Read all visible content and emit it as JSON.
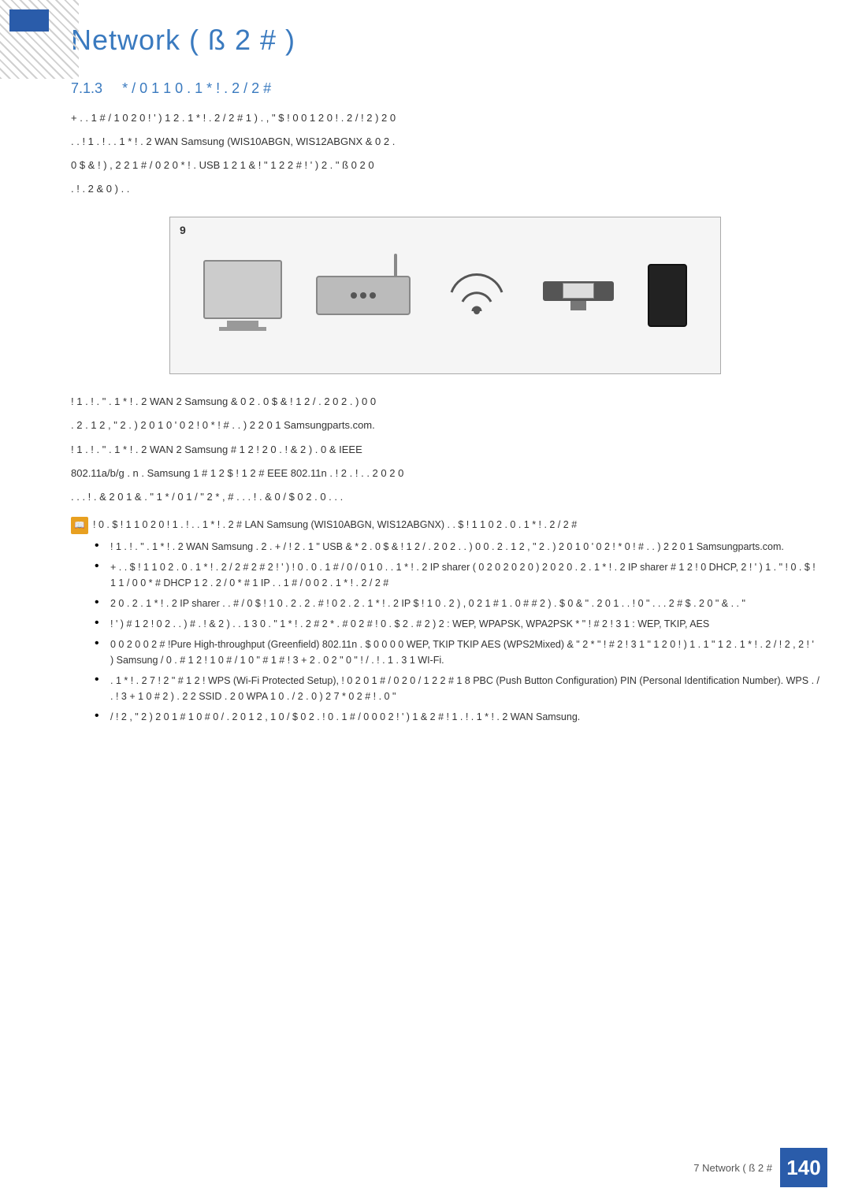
{
  "page": {
    "title": "Network ( ß   2 # )",
    "left_strip_visible": true,
    "footer": {
      "text": "7 Network ( ß  2 #",
      "page_number": "140"
    }
  },
  "header": {
    "section_number": "7.1.3",
    "section_title": "* / 0 1  1 0 . 1 * ! . 2 /   2 #"
  },
  "image": {
    "number": "9"
  },
  "paragraphs": {
    "p1": "+ . . 1 #  /  1 0 2 0 !  ' )  1 2 . 1 * ! . 2 /   2 # 1 ) . , \" $ ! 0   0 1 2 0 !  . 2 / !   2   ) 2 0",
    "p2": ".  .  ! 1 . !   . . 1 * ! . 2  WAN Samsung (WIS10ABGN, WIS12ABGNX   & 0  2 .",
    "p3": "0 $ & !  ) , 2 2   1 # / 0 2 0  * ! . USB 1 2  1 & ! \" 1 2   2 # ! ' ) 2 . \" ß 0  2 0",
    "p4": ". ! .  2 & 0  ) . .",
    "p5": "! 1 . !   . \" . 1 * ! . 2  WAN 2  Samsung  & 0  2 . 0 $ & ! 1 2 / . 2  0 2 . ) 0  0",
    "p6": ". 2 . 1 2  , \" 2 . ) 2  0 1 0 ' 0 2 !  0 *  ! # . . ) 2 2   0 1 Samsungparts.com.",
    "p7": "! 1 . !   . \" . 1 * ! . 2  WAN 2  Samsung #  1 2 ! 2 0 . ! & 2 )  . 0  & IEEE",
    "p8": "802.11a/b/g  . n .  Samsung 1 #  1 2  $ ! 1 2  # EEE 802.11n . ! 2 .  ! .  . 2  0 2 0",
    "p9": ". . . ! . &   2 0  1 & . \" 1 *  / 0 1 / \" 2 * , # . . . ! . &  0 / $ 0 2 .  0  . . ."
  },
  "note": {
    "icon_text": "z",
    "items": [
      {
        "label": "! 0  . $ ! 1   1 0 2 0 ! 1 . !   . . 1 * ! . 2  # LAN Samsung (WIS10ABGN, WIS12ABGNX)  . . $ ! 1   1 0 2 . 0 . 1 * ! . 2 /  2 #"
      },
      {
        "label": "! 1 . !  . \" . 1 * ! . 2  WAN Samsung . 2  . + /  !  2 . 1 \" USB &  * 2 . 0 $ & ! 1 2 / . 2  0 2 . . ) 0  0 . 2 . 1 2  , \" 2 . ) 2  0 1 0 ' 0 2 !   * 0  ! # . . ) 2 2   0 1 Samsungparts.com."
      },
      {
        "label": "+ . . $ ! 1   1 0 2 . 0 . 1 * ! . 2 /  2 # 2 # 2 ! ' )  ! 0  . 0  . 1 # / 0 / 0  1 0 . . 1 * ! . 2 IP sharer ( 0  2 0  2 0  2 0 ) 2 0 2 0 .  2 . 1 * ! . 2 IP sharer #  1 2 ! 0 DHCP, 2  ! ' )  1 . \" ! 0  . $ ! 1   1 / 0 0 * # DHCP  1 2 . 2 / 0 * # 1 IP . . 1 # / 0 0 2 . 1 * ! . 2 /  2 #"
      },
      {
        "label": "2 0 . 2 . 1 * ! . 2 IP sharer . .  # / 0 $ ! 1   0 . 2 . 2  . # ! 0 2 . 2 . 1 * ! . 2 IP $ ! 1  0 . 2 )  , 0 2  1 # 1 . 0 # # 2 ) .  $ 0 & \" . 2  0 1 . . ! 0   \" . . . 2  # $ . 2 0 \"  & . . \""
      },
      {
        "label": "! ' ) # 1 2 ! 0  2 . . ) #  . ! & 2 )  . . 1 3 0  . \" 1 * ! . 2 #  2 * . # 0 2 # ! 0 .  $ 2 . # 2 ) 2 : WEP, WPAPSK, WPA2PSK * \" ! # 2  ! 3 1 : WEP, TKIP, AES",
        "sub_items": [
          "WEP, WPAPSK, WPA2PSK",
          "* \" ! # 2  ! 3 1 : WEP, TKIP, AES"
        ]
      },
      {
        "label": "0   0 2 0 0  2 # !Pure High-throughput (Greenfield) 802.11n . $ 0 0  0 0 WEP, TKIP  TKIP AES (WPS2Mixed) & \" 2 *  \" ! # 2  ! 3 1 \" 1 2  0  ! ) 1 . 1 \" 1 2 . 1 * ! . 2 / !   2 , 2 ! ' ) Samsung / 0 . # 1 2 !  1 0 # / 1 0 \" # 1 #  ! 3 +  2 . 0 2  \" 0 \" ! / . ! . 1 . 3  1 WI-Fi."
      },
      {
        "label": ". 1 * ! . 2 7 !   2 \" #  1 2 ! WPS (Wi-Fi Protected Setup),  ! 0 2 0 1 # / 0 2 0 / 1 2 2 #  1 8 PBC (Push Button Configuration)  PIN (Personal Identification Number).  WPS . / .  ! 3 + 1 0 # 2 )  . 2 2 SSID  . 2  0 WPA 1 0  . /   2 . 0 ) 2 7 *  0 2 # ! . 0 \""
      },
      {
        "label": "/ !   2 , \" 2  ) 2 0  1 # 1 0 # 0 / .  2 0 1 2  , 1 0 / $ 0 2 .  ! 0  . 1 # / 0 0 0 2  ! ' )  1 & 2 #  ! 1 . !   . 1 * ! . 2  WAN Samsung."
      }
    ]
  }
}
